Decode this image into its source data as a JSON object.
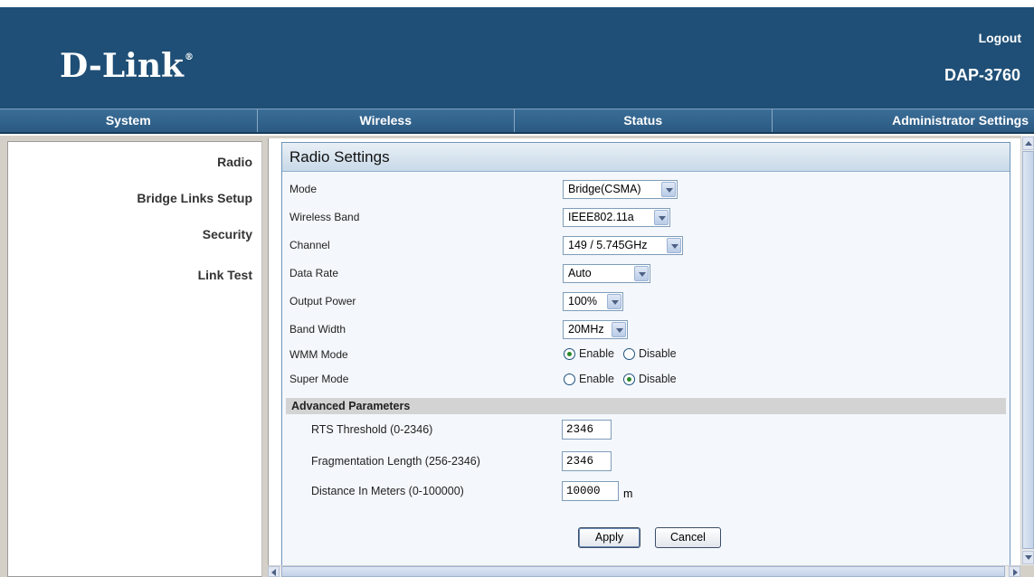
{
  "header": {
    "logo": "D-Link",
    "logo_reg": "®",
    "logout": "Logout",
    "model": "DAP-3760"
  },
  "nav": {
    "tabs": [
      {
        "label": "System"
      },
      {
        "label": "Wireless"
      },
      {
        "label": "Status"
      },
      {
        "label": "Administrator Settings"
      }
    ]
  },
  "sidebar": {
    "items": [
      {
        "label": "Radio"
      },
      {
        "label": "Bridge Links Setup"
      },
      {
        "label": "Security"
      },
      {
        "label": "Link Test"
      }
    ]
  },
  "panel": {
    "title": "Radio Settings",
    "fields": {
      "mode": {
        "label": "Mode",
        "value": "Bridge(CSMA)"
      },
      "band": {
        "label": "Wireless Band",
        "value": "IEEE802.11a"
      },
      "channel": {
        "label": "Channel",
        "value": "149 / 5.745GHz"
      },
      "rate": {
        "label": "Data Rate",
        "value": "Auto"
      },
      "power": {
        "label": "Output Power",
        "value": "100%"
      },
      "bandwidth": {
        "label": "Band Width",
        "value": "20MHz"
      },
      "wmm": {
        "label": "WMM Mode",
        "enable": "Enable",
        "disable": "Disable",
        "selected": "Enable"
      },
      "super": {
        "label": "Super Mode",
        "enable": "Enable",
        "disable": "Disable",
        "selected": "Disable"
      }
    },
    "advanced": {
      "title": "Advanced Parameters",
      "rts": {
        "label": "RTS Threshold (0-2346)",
        "value": "2346"
      },
      "frag": {
        "label": "Fragmentation Length (256-2346)",
        "value": "2346"
      },
      "distance": {
        "label": "Distance In Meters (0-100000)",
        "value": "10000",
        "unit": "m"
      }
    },
    "buttons": {
      "apply": "Apply",
      "cancel": "Cancel"
    }
  }
}
